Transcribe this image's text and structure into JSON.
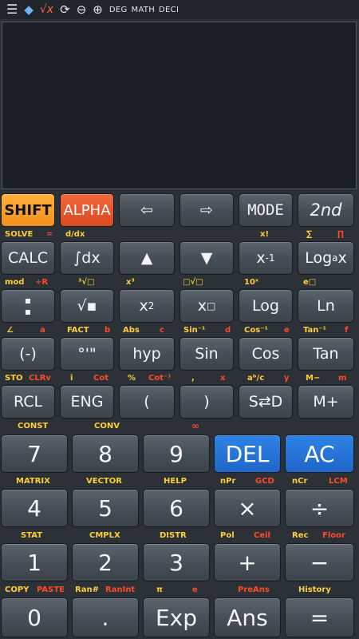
{
  "status_bar": {
    "icons": [
      "menu-icon",
      "diamond-icon",
      "sqrt-x-icon",
      "refresh-icon",
      "minus-circle-icon",
      "plus-circle-icon"
    ],
    "sqrt_label": "√x",
    "angle_mode": "DEG",
    "input_mode": "MATH",
    "number_format": "DECI"
  },
  "display": {
    "expression": "",
    "result": ""
  },
  "row1": {
    "shift": "SHIFT",
    "alpha": "ALPHA",
    "left": "⇦",
    "right": "⇨",
    "mode": "MODE",
    "second": "2nd"
  },
  "row1_labels": {
    "solve": "SOLVE",
    "eq": "=",
    "ddx": "d/dx",
    "fact": "x!",
    "sigma": "∑",
    "pi": "∏"
  },
  "row2": {
    "calc": "CALC",
    "integral": "∫dx",
    "up": "▲",
    "down": "▼",
    "inverse_base": "x",
    "inverse_exp": "-1",
    "log_base": "Log",
    "log_sub": "a",
    "log_x": "x"
  },
  "row2_labels": {
    "mod": "mod",
    "rem": "÷R",
    "cuberoot": "³√□",
    "cube": "x³",
    "nroot": "□√□",
    "tenx": "10ˣ",
    "epow": "e□"
  },
  "row3": {
    "frac": "▪▪",
    "sqrt": "√▪",
    "sq_base": "x",
    "sq_exp": "2",
    "pow_base": "x",
    "pow_exp": "□",
    "log": "Log",
    "ln": "Ln"
  },
  "row3_labels": {
    "angle": "∠",
    "a": "a",
    "fact": "FACT",
    "b": "b",
    "abs": "Abs",
    "c": "c",
    "asin": "Sin⁻¹",
    "d": "d",
    "acos": "Cos⁻¹",
    "e": "e",
    "atan": "Tan⁻¹",
    "f": "f"
  },
  "row4": {
    "neg": "(-)",
    "dms": "°'\"",
    "hyp": "hyp",
    "sin": "Sin",
    "cos": "Cos",
    "tan": "Tan"
  },
  "row4_labels": {
    "sto": "STO",
    "clrv": "CLRv",
    "i": "i",
    "cot": "Cot",
    "pct": "%",
    "acot": "Cot⁻¹",
    "comma": ",",
    "x": "x",
    "abc": "aᵇ/c",
    "y": "y",
    "mminus": "M−",
    "m": "m"
  },
  "row5": {
    "rcl": "RCL",
    "eng": "ENG",
    "lparen": "(",
    "rparen": ")",
    "sd": "S⇄D",
    "mplus": "M+"
  },
  "row5_labels": {
    "const": "CONST",
    "conv": "CONV",
    "inf": "∞"
  },
  "row6": {
    "k7": "7",
    "k8": "8",
    "k9": "9",
    "del": "DEL",
    "ac": "AC"
  },
  "row6_labels": {
    "matrix": "MATRIX",
    "vector": "VECTOR",
    "help": "HELP",
    "npr": "nPr",
    "gcd": "GCD",
    "ncr": "nCr",
    "lcm": "LCM"
  },
  "row7": {
    "k4": "4",
    "k5": "5",
    "k6": "6",
    "mul": "×",
    "div": "÷"
  },
  "row7_labels": {
    "stat": "STAT",
    "cmplx": "CMPLX",
    "distr": "DISTR",
    "pol": "Pol",
    "ceil": "Ceil",
    "rec": "Rec",
    "floor": "Floor"
  },
  "row8": {
    "k1": "1",
    "k2": "2",
    "k3": "3",
    "plus": "+",
    "minus": "−"
  },
  "row8_labels": {
    "copy": "COPY",
    "paste": "PASTE",
    "ran": "Ran#",
    "ranint": "RanInt",
    "pi": "π",
    "e": "e",
    "preans": "PreAns",
    "history": "History"
  },
  "row9": {
    "k0": "0",
    "dot": ".",
    "exp": "Exp",
    "ans": "Ans",
    "eq": "="
  },
  "colors": {
    "shift": "#f7a12a",
    "alpha": "#e4542b",
    "blue": "#2574d8",
    "shift_text": "#ffcf33",
    "alpha_text": "#ff4a2a",
    "key": "#4b535c",
    "background": "#2c3138"
  }
}
